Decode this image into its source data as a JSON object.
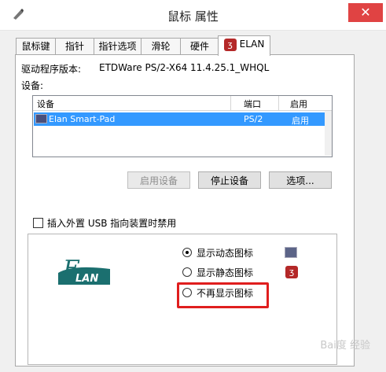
{
  "window": {
    "title": "鼠标 属性",
    "close_glyph": "✕"
  },
  "tabs": [
    {
      "label": "鼠标键"
    },
    {
      "label": "指针"
    },
    {
      "label": "指针选项"
    },
    {
      "label": "滑轮"
    },
    {
      "label": "硬件"
    },
    {
      "label": "ELAN",
      "active": true
    }
  ],
  "driver": {
    "label": "驱动程序版本:",
    "value": "ETDWare PS/2-X64 11.4.25.1_WHQL"
  },
  "devices": {
    "label": "设备:",
    "columns": [
      "设备",
      "端口",
      "启用"
    ],
    "rows": [
      {
        "device": "Elan Smart-Pad",
        "port": "PS/2",
        "enabled": "启用"
      }
    ]
  },
  "buttons": {
    "enable": "启用设备",
    "disable": "停止设备",
    "options": "选项..."
  },
  "usb_checkbox": {
    "label": "插入外置 USB 指向装置时禁用",
    "checked": false
  },
  "tray_icon": {
    "logo_text": "LAN",
    "logo_e": "E",
    "options": [
      {
        "label": "显示动态图标",
        "selected": true
      },
      {
        "label": "显示静态图标",
        "selected": false
      },
      {
        "label": "不再显示图标",
        "selected": false
      }
    ]
  },
  "watermark": "Bai度 经验",
  "colors": {
    "selection": "#3399ff",
    "highlight_box": "#e01e1e",
    "close": "#e04343",
    "elan_red": "#b42828",
    "logo_teal": "#1b6f6f"
  }
}
